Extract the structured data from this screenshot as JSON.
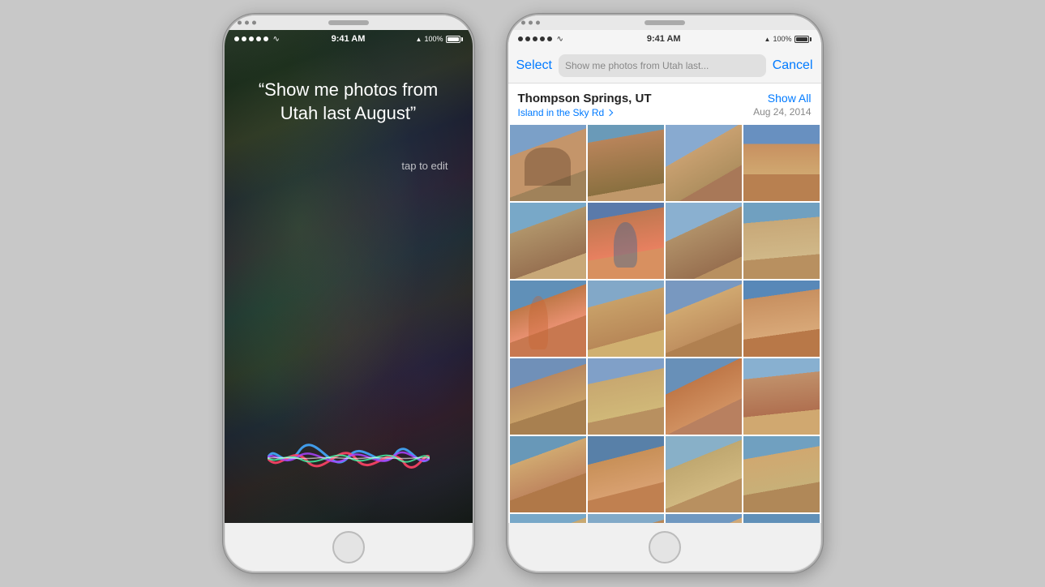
{
  "background_color": "#c8c8c8",
  "siri_phone": {
    "status_bar": {
      "dots": 5,
      "wifi": "wifi",
      "time": "9:41 AM",
      "location": "▲",
      "battery_pct": "100%"
    },
    "quote": "“Show me photos from Utah last August”",
    "tap_to_edit": "tap to edit"
  },
  "photos_phone": {
    "status_bar": {
      "dots": 5,
      "wifi": "wifi",
      "time": "9:41 AM",
      "location": "▲",
      "battery_pct": "100%"
    },
    "navbar": {
      "select_label": "Select",
      "search_placeholder": "Show me photos from Utah last...",
      "cancel_label": "Cancel"
    },
    "location_section": {
      "name": "Thompson Springs, UT",
      "sub_location": "Island in the Sky Rd",
      "show_all": "Show All",
      "date": "Aug 24, 2014"
    },
    "photos": [
      {
        "id": "p1",
        "row": 1
      },
      {
        "id": "p2",
        "row": 1
      },
      {
        "id": "p3",
        "row": 1
      },
      {
        "id": "p4",
        "row": 1
      },
      {
        "id": "p5",
        "row": 2
      },
      {
        "id": "p6",
        "row": 2
      },
      {
        "id": "p7",
        "row": 2
      },
      {
        "id": "p8",
        "row": 2
      },
      {
        "id": "p9",
        "row": 3
      },
      {
        "id": "p10",
        "row": 3
      },
      {
        "id": "p11",
        "row": 3
      },
      {
        "id": "p12",
        "row": 3
      },
      {
        "id": "p13",
        "row": 4
      },
      {
        "id": "p14",
        "row": 4
      },
      {
        "id": "p15",
        "row": 4
      },
      {
        "id": "p16",
        "row": 4
      },
      {
        "id": "p17",
        "row": 5
      },
      {
        "id": "p18",
        "row": 5
      },
      {
        "id": "p19",
        "row": 5
      },
      {
        "id": "p20",
        "row": 5
      },
      {
        "id": "p21",
        "row": 6
      },
      {
        "id": "p22",
        "row": 6
      },
      {
        "id": "p23",
        "row": 6
      },
      {
        "id": "p24",
        "row": 6
      }
    ]
  }
}
